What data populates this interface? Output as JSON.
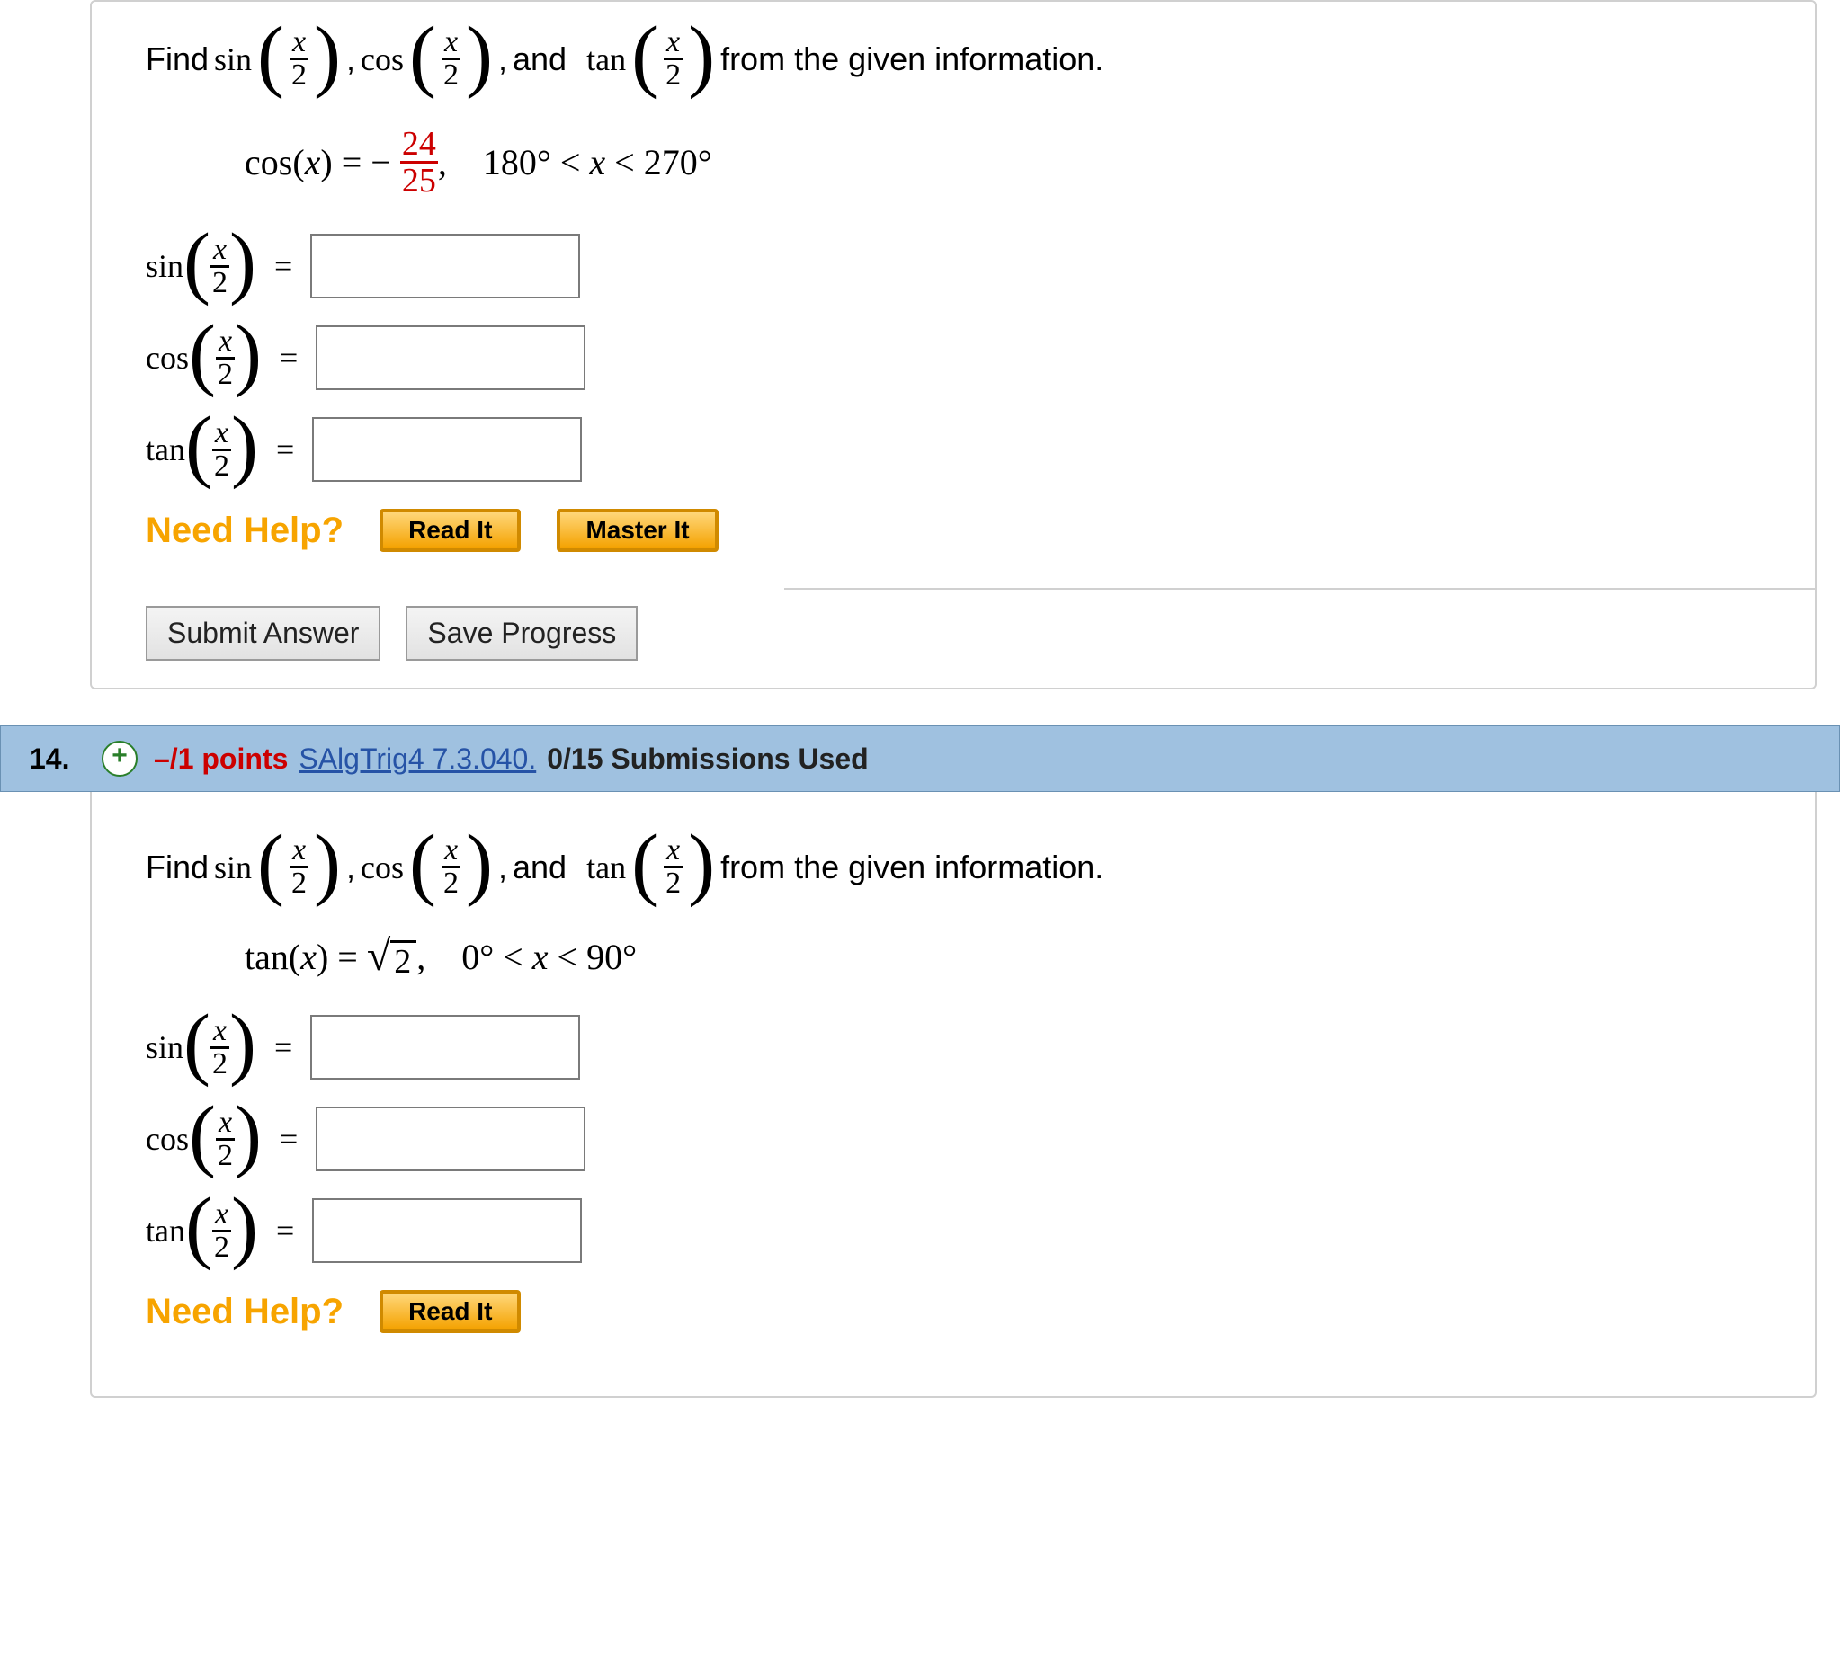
{
  "q1": {
    "prompt_prefix": "Find  ",
    "sin": "sin",
    "cos": "cos",
    "tan": "tan",
    "and": "and",
    "comma": ", ",
    "arg_num": "x",
    "arg_den": "2",
    "prompt_suffix": "  from the given information.",
    "given_cosx": "cos(x) = −",
    "frac_top": "24",
    "frac_bot": "25",
    "frac_comma": ",",
    "range": "180° < x < 270°",
    "eq": "=",
    "help_label": "Need Help?",
    "read_it": "Read It",
    "master_it": "Master It",
    "submit": "Submit Answer",
    "save": "Save Progress"
  },
  "hdr": {
    "num": "14.",
    "expand": "+",
    "pts": "–/1 points",
    "book": "SAlgTrig4 7.3.040.",
    "subs": "0/15 Submissions Used"
  },
  "q2": {
    "prompt_prefix": "Find  ",
    "sin": "sin",
    "cos": "cos",
    "tan": "tan",
    "and": "and",
    "comma": ", ",
    "arg_num": "x",
    "arg_den": "2",
    "prompt_suffix": "  from the given information.",
    "given_tanx": "tan(x) = ",
    "root_val": "2",
    "root_comma": ",",
    "range": "0° < x < 90°",
    "eq": "=",
    "help_label": "Need Help?",
    "read_it": "Read It"
  }
}
